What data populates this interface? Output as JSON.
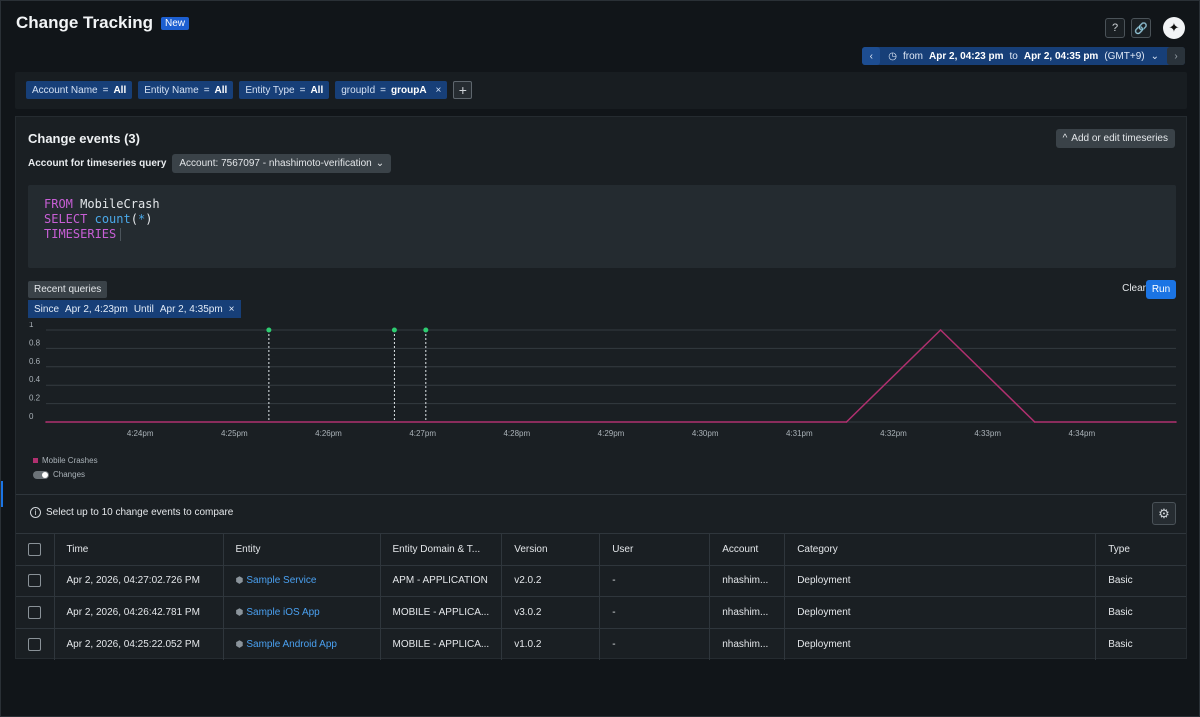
{
  "header": {
    "title": "Change Tracking",
    "badge": "New"
  },
  "time_picker": {
    "prefix": "from",
    "from": "Apr 2, 04:23 pm",
    "to_word": "to",
    "to": "Apr 2, 04:35 pm",
    "tz": "(GMT+9)"
  },
  "filters": [
    {
      "key": "Account Name",
      "op": "=",
      "value": "All"
    },
    {
      "key": "Entity Name",
      "op": "=",
      "value": "All"
    },
    {
      "key": "Entity Type",
      "op": "=",
      "value": "All"
    },
    {
      "key": "groupId",
      "op": "=",
      "value": "groupA"
    }
  ],
  "panel": {
    "title": "Change events (3)",
    "add_timeseries": "Add or edit timeseries",
    "account_label": "Account for timeseries query",
    "account_value": "Account: 7567097 - nhashimoto-verification"
  },
  "query": {
    "line1_kw": "FROM",
    "line1_rest": "MobileCrash",
    "line2_kw": "SELECT",
    "line2_fn": "count",
    "line2_open": "(",
    "line2_arg": "*",
    "line2_close": ")",
    "line3_kw": "TIMESERIES"
  },
  "recent_queries": "Recent queries",
  "since_chip": {
    "since_label": "Since",
    "since": "Apr 2, 4:23pm",
    "until_label": "Until",
    "until": "Apr 2, 4:35pm"
  },
  "actions": {
    "clear": "Clear",
    "run": "Run"
  },
  "chart_data": {
    "type": "line",
    "y_ticks": [
      "1",
      "0.8",
      "0.6",
      "0.4",
      "0.2",
      "0"
    ],
    "ylim": [
      0,
      1
    ],
    "x_ticks": [
      "4:24pm",
      "4:25pm",
      "4:26pm",
      "4:27pm",
      "4:28pm",
      "4:29pm",
      "4:30pm",
      "4:31pm",
      "4:32pm",
      "4:33pm",
      "4:34pm"
    ],
    "series": [
      {
        "name": "Mobile Crashes",
        "color": "#b0306f",
        "x": [
          "4:23pm",
          "4:31:30pm",
          "4:32:30pm",
          "4:33:30pm",
          "4:35pm"
        ],
        "values": [
          0,
          0,
          1,
          0,
          0
        ]
      }
    ],
    "change_markers": [
      "4:25:22pm",
      "4:26:42pm",
      "4:27:02pm"
    ],
    "marker_color": "#2ecc71"
  },
  "legend": {
    "series": "Mobile Crashes",
    "changes": "Changes"
  },
  "compare_hint": "Select up to 10 change events to compare",
  "table": {
    "columns": [
      "Time",
      "Entity",
      "Entity Domain & T...",
      "Version",
      "User",
      "Account",
      "Category",
      "Type"
    ],
    "rows": [
      {
        "time": "Apr 2, 2026, 04:27:02.726 PM",
        "entity": "Sample Service",
        "domain": "APM - APPLICATION",
        "version": "v2.0.2",
        "user": "-",
        "account": "nhashim...",
        "category": "Deployment",
        "type": "Basic"
      },
      {
        "time": "Apr 2, 2026, 04:26:42.781 PM",
        "entity": "Sample iOS App",
        "domain": "MOBILE - APPLICA...",
        "version": "v3.0.2",
        "user": "-",
        "account": "nhashim...",
        "category": "Deployment",
        "type": "Basic"
      },
      {
        "time": "Apr 2, 2026, 04:25:22.052 PM",
        "entity": "Sample Android App",
        "domain": "MOBILE - APPLICA...",
        "version": "v1.0.2",
        "user": "-",
        "account": "nhashim...",
        "category": "Deployment",
        "type": "Basic"
      }
    ]
  }
}
